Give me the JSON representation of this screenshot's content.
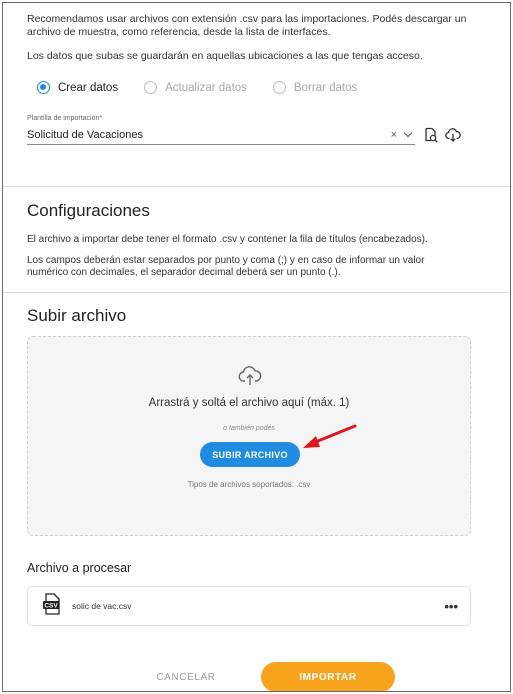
{
  "intro": {
    "line1": "Recomendamos usar archivos con extensión .csv para las importaciones. Podés descargar un archivo de muestra, como referencia, desde la lista de interfaces.",
    "line2": "Los datos que subas se guardarán en aquellas ubicaciones a las que tengas acceso."
  },
  "mode": {
    "options": [
      "Crear datos",
      "Actualizar datos",
      "Borrar datos"
    ],
    "selected": "Crear datos"
  },
  "template": {
    "label": "Plantilla de importación*",
    "value": "Solicitud de Vacaciones",
    "clear_glyph": "×",
    "icons": [
      "search-document-icon",
      "cloud-download-icon"
    ]
  },
  "config": {
    "title": "Configuraciones",
    "p1": "El archivo a importar debe tener el formato .csv y contener la fila de títulos (encabezados).",
    "p2": "Los campos deberán estar separados por punto y coma (;) y en caso de informar un valor numérico con decimales, el separador decimal deberá ser un punto (.)."
  },
  "upload": {
    "title": "Subir archivo",
    "drop_text": "Arrastrá y soltá el archivo aquí (máx. 1)",
    "or_text": "o también podés",
    "button": "SUBIR ARCHIVO",
    "types": "Tipos de archivos soportados: .csv"
  },
  "processing": {
    "title": "Archivo a procesar",
    "file_name": "solic de vac.csv",
    "file_badge": "CSV",
    "more": "•••"
  },
  "actions": {
    "cancel": "CANCELAR",
    "import": "IMPORTAR"
  },
  "colors": {
    "accent_blue": "#1f8ce0",
    "import_orange": "#f7a31c",
    "arrow_red": "#e0161e"
  }
}
